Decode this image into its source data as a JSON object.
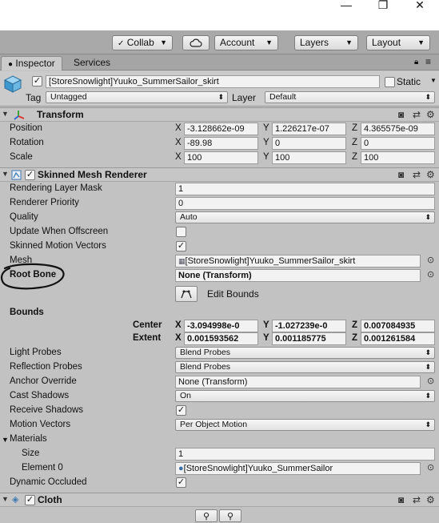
{
  "window": {
    "minimize": "—",
    "maximize": "❐",
    "close": "✕"
  },
  "toolbar": {
    "collab": "Collab",
    "account": "Account",
    "layers": "Layers",
    "layout": "Layout"
  },
  "tabs": [
    "Inspector",
    "Services"
  ],
  "object": {
    "name": "[StoreSnowlight]Yuuko_SummerSailor_skirt",
    "static_label": "Static",
    "tag_label": "Tag",
    "tag_value": "Untagged",
    "layer_label": "Layer",
    "layer_value": "Default"
  },
  "transform": {
    "title": "Transform",
    "position_label": "Position",
    "rotation_label": "Rotation",
    "scale_label": "Scale",
    "position": {
      "x": "-3.128662e-09",
      "y": "1.226217e-07",
      "z": "4.365575e-09"
    },
    "rotation": {
      "x": "-89.98",
      "y": "0",
      "z": "0"
    },
    "scale": {
      "x": "100",
      "y": "100",
      "z": "100"
    }
  },
  "axis": {
    "x": "X",
    "y": "Y",
    "z": "Z"
  },
  "smr": {
    "title": "Skinned Mesh Renderer",
    "rendering_layer_mask_label": "Rendering Layer Mask",
    "rendering_layer_mask": "1",
    "renderer_priority_label": "Renderer Priority",
    "renderer_priority": "0",
    "quality_label": "Quality",
    "quality": "Auto",
    "update_offscreen_label": "Update When Offscreen",
    "skinned_motion_vectors_label": "Skinned Motion Vectors",
    "mesh_label": "Mesh",
    "mesh": "[StoreSnowlight]Yuuko_SummerSailor_skirt",
    "root_bone_label": "Root Bone",
    "root_bone": "None (Transform)",
    "edit_bounds": "Edit Bounds",
    "bounds_label": "Bounds",
    "center_label": "Center",
    "extent_label": "Extent",
    "center": {
      "x": "-3.094998e-0",
      "y": "-1.027239e-0",
      "z": "0.007084935"
    },
    "extent": {
      "x": "0.001593562",
      "y": "0.001185775",
      "z": "0.001261584"
    },
    "light_probes_label": "Light Probes",
    "light_probes": "Blend Probes",
    "reflection_probes_label": "Reflection Probes",
    "reflection_probes": "Blend Probes",
    "anchor_override_label": "Anchor Override",
    "anchor_override": "None (Transform)",
    "cast_shadows_label": "Cast Shadows",
    "cast_shadows": "On",
    "receive_shadows_label": "Receive Shadows",
    "motion_vectors_label": "Motion Vectors",
    "motion_vectors": "Per Object Motion",
    "materials_label": "Materials",
    "size_label": "Size",
    "size": "1",
    "element0_label": "Element 0",
    "element0": "[StoreSnowlight]Yuuko_SummerSailor",
    "dynamic_occluded_label": "Dynamic Occluded"
  },
  "cloth": {
    "title": "Cloth"
  },
  "colors": {
    "panel": "#c2c2c2",
    "toolbar": "#a9a9a9",
    "field": "#f2f2f2",
    "annotation": "#111111"
  },
  "icons": [
    "cloud-icon",
    "lock-icon",
    "menu-icon",
    "help-icon",
    "preset-icon",
    "gear-icon",
    "cube-icon",
    "transform-axes-icon",
    "mesh-renderer-icon",
    "cloth-icon",
    "object-picker-icon"
  ]
}
